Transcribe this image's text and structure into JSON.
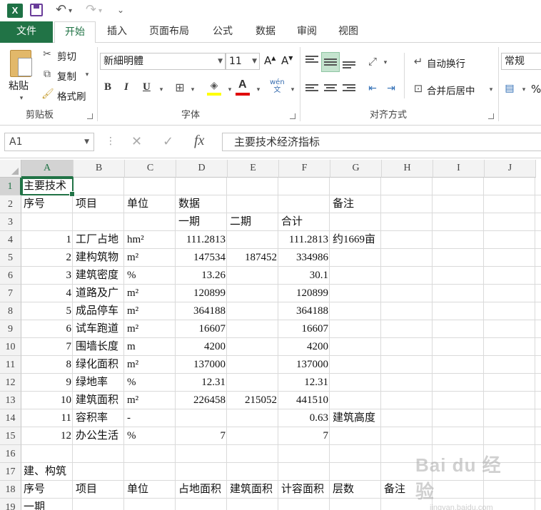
{
  "qat": {
    "undo": "↶",
    "redo": "↷",
    "more": "⌄"
  },
  "tabs": [
    {
      "label": "文件"
    },
    {
      "label": "开始"
    },
    {
      "label": "插入"
    },
    {
      "label": "页面布局"
    },
    {
      "label": "公式"
    },
    {
      "label": "数据"
    },
    {
      "label": "审阅"
    },
    {
      "label": "视图"
    }
  ],
  "ribbon": {
    "clipboard": {
      "paste": "粘贴",
      "cut": "剪切",
      "copy": "复制",
      "format_painter": "格式刷",
      "label": "剪贴板"
    },
    "font": {
      "font_name": "新細明體",
      "font_size": "11",
      "bold": "B",
      "italic": "I",
      "underline": "U",
      "label": "字体",
      "wen": "wén\n文"
    },
    "alignment": {
      "wrap": "自动换行",
      "merge": "合并后居中",
      "label": "对齐方式"
    },
    "number": {
      "format": "常规",
      "percent": "%"
    }
  },
  "formula_bar": {
    "name_box": "A1",
    "fx": "fx",
    "content": "主要技术经济指标"
  },
  "columns": [
    "A",
    "B",
    "C",
    "D",
    "E",
    "F",
    "G",
    "H",
    "I",
    "J"
  ],
  "rows": [
    "1",
    "2",
    "3",
    "4",
    "5",
    "6",
    "7",
    "8",
    "9",
    "10",
    "11",
    "12",
    "13",
    "14",
    "15",
    "16",
    "17",
    "18",
    "19"
  ],
  "cells": {
    "r1": [
      "主要技术"
    ],
    "r2": [
      "序号",
      "项目",
      "单位",
      "数据",
      "备注"
    ],
    "r3": [
      "一期",
      "二期",
      "合计"
    ],
    "data": [
      {
        "no": "1",
        "item": "工厂占地",
        "unit": "hm²",
        "d": "111.2813",
        "e": "",
        "f": "111.2813",
        "g": "约1669亩"
      },
      {
        "no": "2",
        "item": "建构筑物",
        "unit": "m²",
        "d": "147534",
        "e": "187452",
        "f": "334986",
        "g": ""
      },
      {
        "no": "3",
        "item": "建筑密度",
        "unit": "%",
        "d": "13.26",
        "e": "",
        "f": "30.1",
        "g": ""
      },
      {
        "no": "4",
        "item": "道路及广",
        "unit": "m²",
        "d": "120899",
        "e": "",
        "f": "120899",
        "g": ""
      },
      {
        "no": "5",
        "item": "成品停车",
        "unit": "m²",
        "d": "364188",
        "e": "",
        "f": "364188",
        "g": ""
      },
      {
        "no": "6",
        "item": "试车跑道",
        "unit": "m²",
        "d": "16607",
        "e": "",
        "f": "16607",
        "g": ""
      },
      {
        "no": "7",
        "item": "围墙长度",
        "unit": "m",
        "d": "4200",
        "e": "",
        "f": "4200",
        "g": ""
      },
      {
        "no": "8",
        "item": "绿化面积",
        "unit": "m²",
        "d": "137000",
        "e": "",
        "f": "137000",
        "g": ""
      },
      {
        "no": "9",
        "item": "绿地率",
        "unit": "%",
        "d": "12.31",
        "e": "",
        "f": "12.31",
        "g": ""
      },
      {
        "no": "10",
        "item": "建筑面积",
        "unit": "m²",
        "d": "226458",
        "e": "215052",
        "f": "441510",
        "g": ""
      },
      {
        "no": "11",
        "item": "容积率",
        "unit": "-",
        "d": "",
        "e": "",
        "f": "0.63",
        "g": "建筑高度"
      },
      {
        "no": "12",
        "item": "办公生活",
        "unit": "%",
        "d": "7",
        "e": "",
        "f": "7",
        "g": ""
      }
    ],
    "r17": [
      "建、构筑"
    ],
    "r18": [
      "序号",
      "项目",
      "单位",
      "占地面积",
      "建筑面积",
      "计容面积",
      "层数",
      "备注"
    ],
    "r19": [
      "一期"
    ]
  },
  "watermark": {
    "line1": "Bai du 经验",
    "line2": "jingyan.baidu.com"
  }
}
